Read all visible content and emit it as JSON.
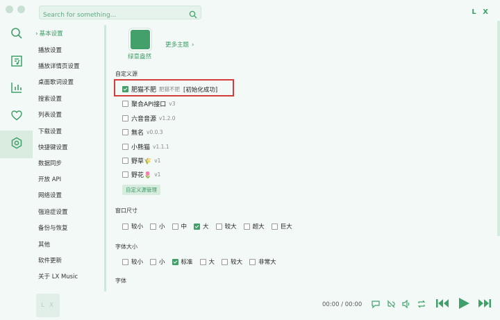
{
  "search": {
    "placeholder": "Search for something..."
  },
  "brand": "L X",
  "sidebar": {
    "items": [
      {
        "label": "基本设置",
        "active": true
      },
      {
        "label": "播放设置"
      },
      {
        "label": "播放详情页设置"
      },
      {
        "label": "桌面歌词设置"
      },
      {
        "label": "搜索设置"
      },
      {
        "label": "列表设置"
      },
      {
        "label": "下载设置"
      },
      {
        "label": "快捷键设置"
      },
      {
        "label": "数据同步"
      },
      {
        "label": "开放 API"
      },
      {
        "label": "网络设置"
      },
      {
        "label": "强迫症设置"
      },
      {
        "label": "备份与恢复"
      },
      {
        "label": "其他"
      },
      {
        "label": "软件更新"
      },
      {
        "label": "关于 LX Music"
      }
    ]
  },
  "theme": {
    "name": "绿意盎然",
    "more": "更多主题"
  },
  "sources": {
    "title": "自定义源",
    "items": [
      {
        "name": "肥猫不肥",
        "version": "肥猫不肥",
        "status": "[初始化成功]",
        "checked": true
      },
      {
        "name": "聚合API接口",
        "version": "v3",
        "checked": false
      },
      {
        "name": "六音音源",
        "version": "v1.2.0",
        "checked": false
      },
      {
        "name": "無名",
        "version": "v0.0.3",
        "checked": false
      },
      {
        "name": "小熊猫",
        "version": "v1.1.1",
        "checked": false
      },
      {
        "name": "野草🌾",
        "version": "v1",
        "checked": false
      },
      {
        "name": "野花🌷",
        "version": "v1",
        "checked": false
      }
    ],
    "manage_button": "自定义源管理"
  },
  "window_size": {
    "title": "窗口尺寸",
    "options": [
      {
        "label": "较小",
        "checked": false
      },
      {
        "label": "小",
        "checked": false
      },
      {
        "label": "中",
        "checked": false
      },
      {
        "label": "大",
        "checked": true
      },
      {
        "label": "较大",
        "checked": false
      },
      {
        "label": "超大",
        "checked": false
      },
      {
        "label": "巨大",
        "checked": false
      }
    ]
  },
  "font_size": {
    "title": "字体大小",
    "options": [
      {
        "label": "较小",
        "checked": false
      },
      {
        "label": "小",
        "checked": false
      },
      {
        "label": "标准",
        "checked": true
      },
      {
        "label": "大",
        "checked": false
      },
      {
        "label": "较大",
        "checked": false
      },
      {
        "label": "非常大",
        "checked": false
      }
    ]
  },
  "font": {
    "title": "字体"
  },
  "player": {
    "logo": "L X",
    "time": "00:00 / 00:00"
  },
  "colors": {
    "accent": "#44a06b",
    "highlight": "#d63b3b",
    "background": "#f3f9f6"
  }
}
